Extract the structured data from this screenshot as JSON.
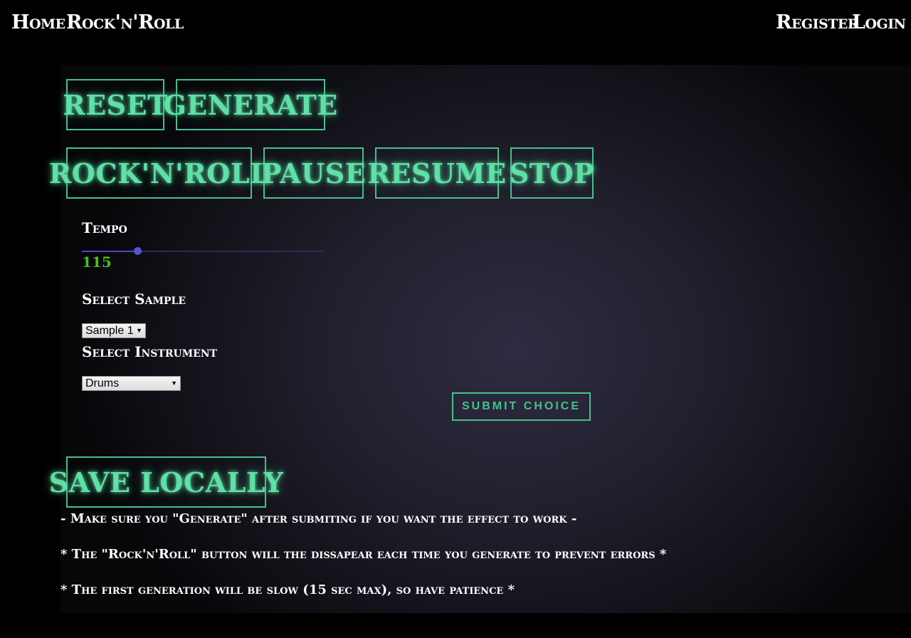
{
  "nav": {
    "home": "Home",
    "rocknroll": "Rock'n'Roll",
    "register": "Register",
    "login": "Login"
  },
  "controls": {
    "reset": "RESET",
    "generate": "GENERATE",
    "rocknroll": "ROCK'N'ROLL",
    "pause": "PAUSE",
    "resume": "RESUME",
    "stop": "STOP",
    "save_locally": "SAVE LOCALLY"
  },
  "tempo": {
    "label": "Tempo",
    "value": "115",
    "level_fraction": 0.23
  },
  "sample": {
    "label": "Select Sample",
    "selected": "Sample 1"
  },
  "instrument": {
    "label": "Select Instrument",
    "selected": "Drums"
  },
  "submit_label": "SUBMIT CHOICE",
  "notes": [
    "- Make sure you \"Generate\" after submiting if you want the effect to work -",
    "* The \"Rock'n'Roll\" button will the dissapear each time you generate to prevent errors *",
    "* The first generation will be slow (15 sec max), so have patience *"
  ],
  "colors": {
    "accent": "#48c08a",
    "glow_text": "#5fe0a6",
    "tempo_value": "#46c21f",
    "slider": "#4b47c2"
  }
}
